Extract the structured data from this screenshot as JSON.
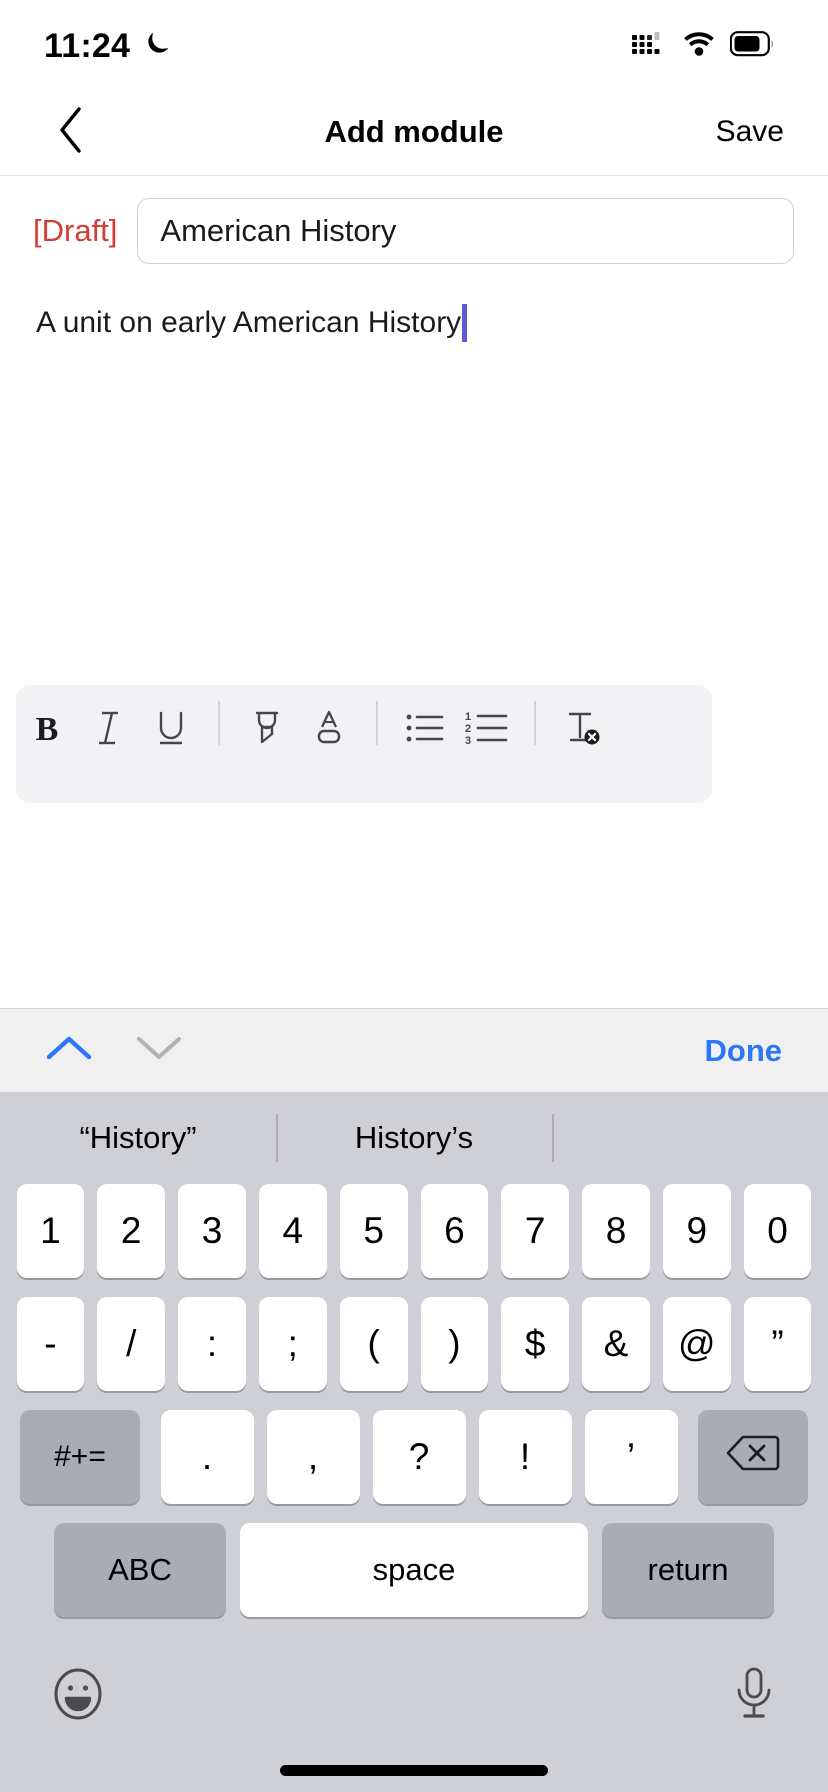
{
  "status_bar": {
    "time": "11:24",
    "dnd_icon": "crescent-moon-icon",
    "signal_icon": "cellular-signal-icon",
    "wifi_icon": "wifi-icon",
    "battery_icon": "battery-icon"
  },
  "nav_bar": {
    "back_icon": "chevron-left-icon",
    "title": "Add module",
    "save_label": "Save"
  },
  "form": {
    "draft_tag": "[Draft]",
    "title_value": "American History",
    "title_placeholder": "Title"
  },
  "editor": {
    "description_text": "A unit on early American History",
    "caret_color": "#5b5bd6"
  },
  "format_toolbar": {
    "buttons": [
      {
        "name": "bold-icon",
        "label": "B"
      },
      {
        "name": "italic-icon",
        "label": "I"
      },
      {
        "name": "underline-icon",
        "label": "U"
      },
      {
        "name": "highlighter-icon",
        "label": ""
      },
      {
        "name": "text-color-icon",
        "label": "A"
      },
      {
        "name": "bulleted-list-icon",
        "label": ""
      },
      {
        "name": "numbered-list-icon",
        "label": "1 2 3"
      },
      {
        "name": "clear-formatting-icon",
        "label": "T"
      }
    ]
  },
  "keyboard_accessory": {
    "prev_icon": "chevron-up-icon",
    "next_icon": "chevron-down-icon",
    "done_label": "Done",
    "done_color": "#2b77f5",
    "prev_enabled_color": "#2b77f5",
    "next_disabled_color": "#b0b0b5"
  },
  "keyboard": {
    "predictions": [
      "“History”",
      "History’s",
      ""
    ],
    "number_row": [
      "1",
      "2",
      "3",
      "4",
      "5",
      "6",
      "7",
      "8",
      "9",
      "0"
    ],
    "symbol_row": [
      "-",
      "/",
      ":",
      ";",
      "(",
      ")",
      "$",
      "&",
      "@",
      "”"
    ],
    "third_row": {
      "modifier": "#+=",
      "keys": [
        ".",
        ",",
        "?",
        "!",
        "’"
      ],
      "backspace_icon": "backspace-icon"
    },
    "bottom_row": {
      "abc": "ABC",
      "space": "space",
      "return": "return"
    },
    "utility_row": {
      "emoji_icon": "emoji-smiley-icon",
      "mic_icon": "microphone-icon"
    },
    "home_indicator": "home-indicator"
  }
}
